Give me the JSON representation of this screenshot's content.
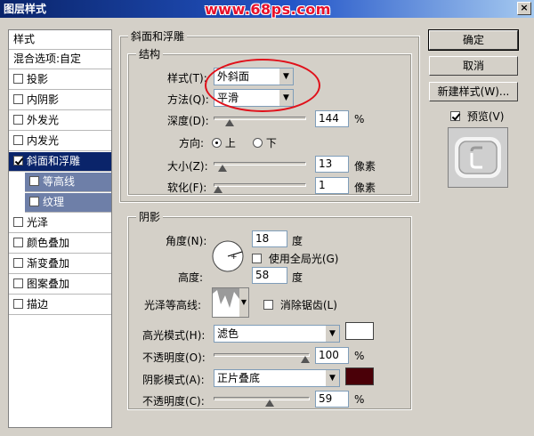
{
  "window": {
    "title": "图层样式",
    "overlay_text": "www.68ps.com",
    "close": "×"
  },
  "style_list": {
    "header": "样式",
    "items": [
      {
        "label": "混合选项:自定",
        "check": "none",
        "state": "normal"
      },
      {
        "label": "投影",
        "check": "unchecked",
        "state": "normal"
      },
      {
        "label": "内阴影",
        "check": "unchecked",
        "state": "normal"
      },
      {
        "label": "外发光",
        "check": "unchecked",
        "state": "normal"
      },
      {
        "label": "内发光",
        "check": "unchecked",
        "state": "normal"
      },
      {
        "label": "斜面和浮雕",
        "check": "checked",
        "state": "active"
      },
      {
        "label": "等高线",
        "check": "unchecked",
        "state": "sub"
      },
      {
        "label": "纹理",
        "check": "unchecked",
        "state": "sub"
      },
      {
        "label": "光泽",
        "check": "unchecked",
        "state": "normal"
      },
      {
        "label": "颜色叠加",
        "check": "unchecked",
        "state": "normal"
      },
      {
        "label": "渐变叠加",
        "check": "unchecked",
        "state": "normal"
      },
      {
        "label": "图案叠加",
        "check": "unchecked",
        "state": "normal"
      },
      {
        "label": "描边",
        "check": "unchecked",
        "state": "normal"
      }
    ]
  },
  "bevel": {
    "section_title": "斜面和浮雕",
    "structure_title": "结构",
    "style_label": "样式(T):",
    "style_value": "外斜面",
    "method_label": "方法(Q):",
    "method_value": "平滑",
    "depth_label": "深度(D):",
    "depth_value": "144",
    "depth_unit": "%",
    "depth_slider": 0.14,
    "direction_label": "方向:",
    "dir_up": "上",
    "dir_down": "下",
    "size_label": "大小(Z):",
    "size_value": "13",
    "size_unit": "像素",
    "size_slider": 0.05,
    "soften_label": "软化(F):",
    "soften_value": "1",
    "soften_unit": "像素",
    "soften_slider": 0.0
  },
  "shading": {
    "title": "阴影",
    "angle_label": "角度(N):",
    "angle_value": "18",
    "angle_unit": "度",
    "global_light_label": "使用全局光(G)",
    "altitude_label": "高度:",
    "altitude_value": "58",
    "altitude_unit": "度",
    "gloss_label": "光泽等高线:",
    "antialias_label": "消除锯齿(L)",
    "highlight_mode_label": "高光模式(H):",
    "highlight_mode_value": "滤色",
    "highlight_color": "#ffffff",
    "highlight_opacity_label": "不透明度(O):",
    "highlight_opacity_value": "100",
    "highlight_opacity_unit": "%",
    "highlight_opacity_slider": 1.0,
    "shadow_mode_label": "阴影模式(A):",
    "shadow_mode_value": "正片叠底",
    "shadow_color": "#4a0008",
    "shadow_opacity_label": "不透明度(C):",
    "shadow_opacity_value": "59",
    "shadow_opacity_unit": "%",
    "shadow_opacity_slider": 0.59
  },
  "buttons": {
    "ok": "确定",
    "cancel": "取消",
    "new_style": "新建样式(W)...",
    "preview": "预览(V)"
  }
}
